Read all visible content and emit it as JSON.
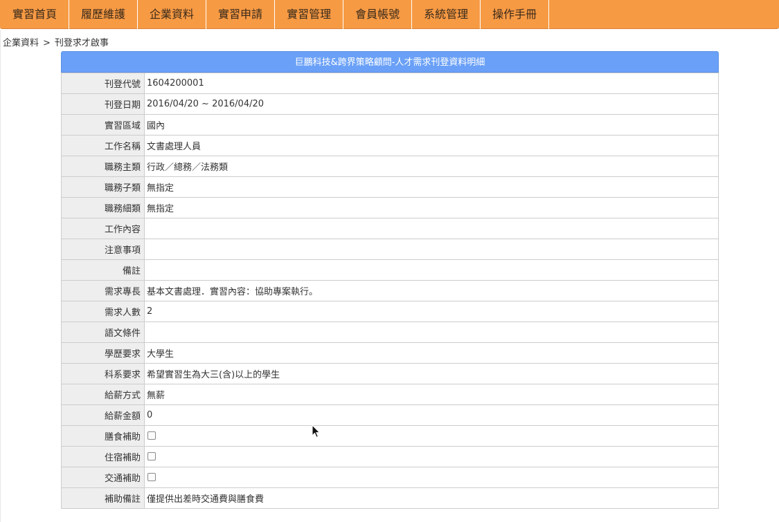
{
  "nav": {
    "items": [
      {
        "label": "實習首頁"
      },
      {
        "label": "履歷維護"
      },
      {
        "label": "企業資料"
      },
      {
        "label": "實習申請"
      },
      {
        "label": "實習管理"
      },
      {
        "label": "會員帳號"
      },
      {
        "label": "系統管理"
      },
      {
        "label": "操作手冊"
      }
    ]
  },
  "breadcrumb": {
    "parent": "企業資料",
    "separator": ">",
    "current": "刊登求才啟事"
  },
  "detail": {
    "title": "巨鵬科技&跨界策略顧問-人才需求刊登資料明細",
    "rows": [
      {
        "label": "刊登代號",
        "value": "1604200001"
      },
      {
        "label": "刊登日期",
        "value": "2016/04/20 ~ 2016/04/20"
      },
      {
        "label": "實習區域",
        "value": "國內"
      },
      {
        "label": "工作名稱",
        "value": "文書處理人員"
      },
      {
        "label": "職務主類",
        "value": "行政／總務／法務類"
      },
      {
        "label": "職務子類",
        "value": "無指定"
      },
      {
        "label": "職務細類",
        "value": "無指定"
      },
      {
        "label": "工作內容",
        "value": ""
      },
      {
        "label": "注意事項",
        "value": ""
      },
      {
        "label": "備註",
        "value": ""
      },
      {
        "label": "需求專長",
        "value": "基本文書處理．實習內容：協助專案執行。"
      },
      {
        "label": "需求人數",
        "value": "2"
      },
      {
        "label": "語文條件",
        "value": ""
      },
      {
        "label": "學歷要求",
        "value": "大學生"
      },
      {
        "label": "科系要求",
        "value": "希望實習生為大三(含)以上的學生"
      },
      {
        "label": "給薪方式",
        "value": "無薪"
      },
      {
        "label": "給薪金額",
        "value": "0"
      },
      {
        "label": "膳食補助",
        "checkbox": true,
        "checked": false
      },
      {
        "label": "住宿補助",
        "checkbox": true,
        "checked": false
      },
      {
        "label": "交通補助",
        "checkbox": true,
        "checked": false
      },
      {
        "label": "補助備註",
        "value": "僅提供出差時交通費與膳食費"
      }
    ]
  },
  "colors": {
    "nav_bg": "#f79a44",
    "header_bg": "#6aa0f7",
    "label_bg": "#eeeeee",
    "border": "#cccccc"
  },
  "icons": {
    "cursor": "mouse-pointer-icon"
  }
}
